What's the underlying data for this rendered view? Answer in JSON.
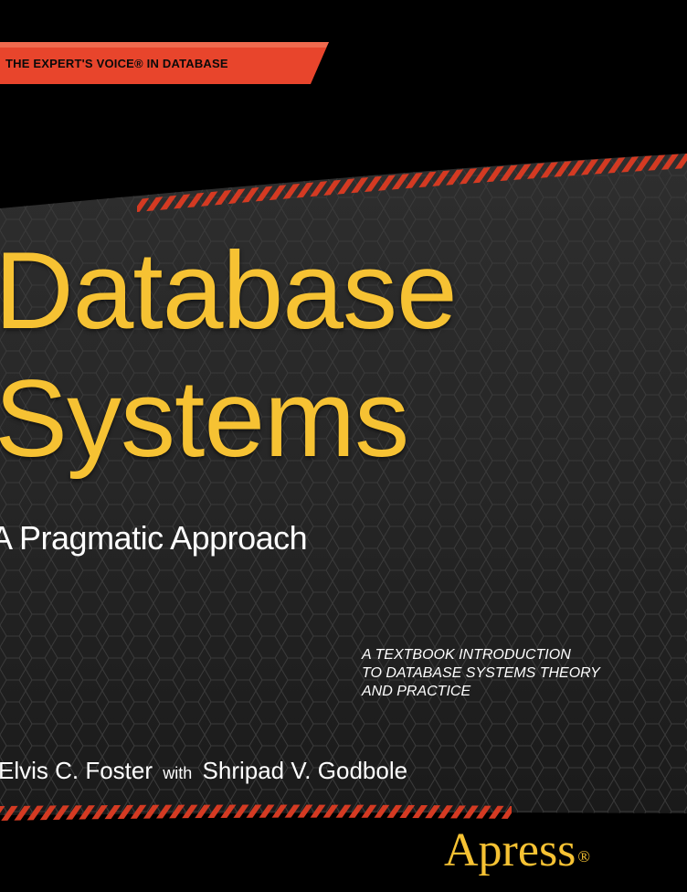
{
  "banner": {
    "text": "THE EXPERT'S VOICE® IN DATABASE"
  },
  "title": {
    "line1": "Database",
    "line2": "Systems"
  },
  "subtitle": "A Pragmatic Approach",
  "tagline": {
    "line1": "A TEXTBOOK INTRODUCTION",
    "line2": "TO DATABASE SYSTEMS THEORY",
    "line3": "AND PRACTICE"
  },
  "authors": {
    "primary": "Elvis C. Foster",
    "connector": "with",
    "secondary": "Shripad V. Godbole"
  },
  "publisher": {
    "name": "Apress",
    "mark": "®"
  },
  "colors": {
    "background": "#000000",
    "accent_orange": "#e8452c",
    "title_gold": "#f6c233",
    "band_dark": "#2c2c2c"
  }
}
